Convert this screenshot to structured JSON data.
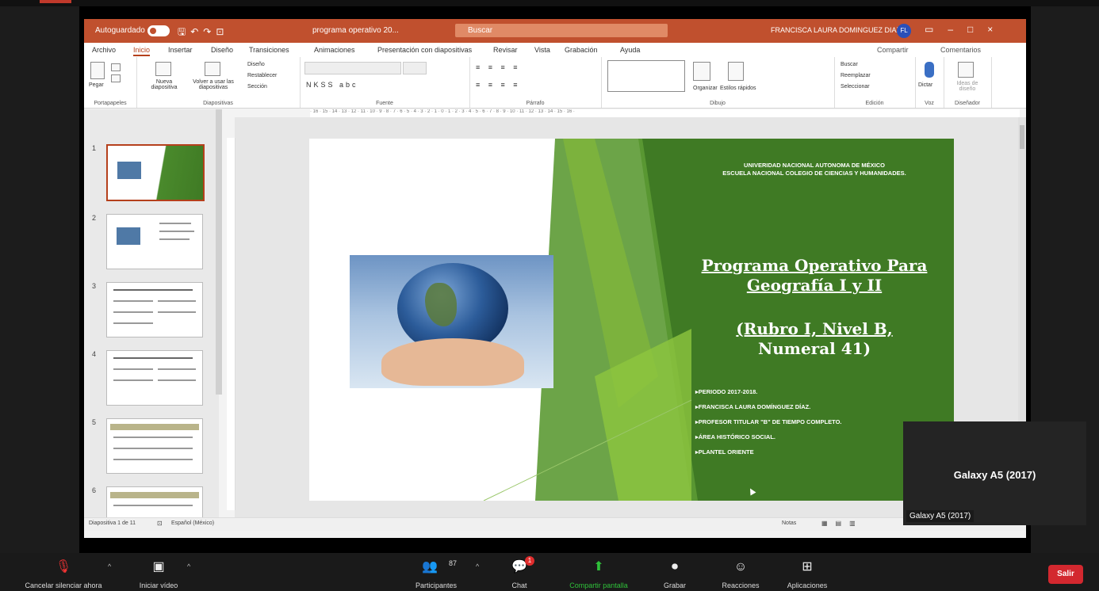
{
  "powerpoint": {
    "autosave_label": "Autoguardado",
    "filename": "programa operativo 20...",
    "search_placeholder": "Buscar",
    "user_name": "FRANCISCA LAURA DOMINGUEZ DIAZ",
    "user_initials": "FL",
    "tabs": [
      "Archivo",
      "Inicio",
      "Insertar",
      "Diseño",
      "Transiciones",
      "Animaciones",
      "Presentación con diapositivas",
      "Revisar",
      "Vista",
      "Grabación",
      "Ayuda"
    ],
    "active_tab": "Inicio",
    "share_label": "Compartir",
    "comments_label": "Comentarios",
    "ribbon_groups": [
      "Portapapeles",
      "Diapositivas",
      "Fuente",
      "Párrafo",
      "Dibujo",
      "Edición",
      "Voz",
      "Diseñador"
    ],
    "ribbon_buttons": {
      "paste": "Pegar",
      "new_slide": "Nueva diapositiva",
      "reuse": "Volver a usar las diapositivas",
      "layout": "Diseño",
      "reset": "Restablecer",
      "section": "Sección",
      "arrange": "Organizar",
      "quick_styles": "Estilos rápidos",
      "find": "Buscar",
      "replace": "Reemplazar",
      "select": "Seleccionar",
      "dictate": "Dictar",
      "designer": "Ideas de diseño"
    },
    "thumbnail_numbers": [
      "1",
      "2",
      "3",
      "4",
      "5",
      "6"
    ],
    "selected_thumbnail": 1,
    "status": {
      "slide_info": "Diapositiva 1 de 11",
      "language": "Español (México)",
      "notes": "Notas"
    }
  },
  "slide": {
    "university": "UNIVERIDAD NACIONAL AUTONOMA DE MÉXICO",
    "school": "ESCUELA NACIONAL COLEGIO DE CIENCIAS Y HUMANIDADES.",
    "title_line1": "Programa Operativo Para",
    "title_line2": "Geografía I y II",
    "subtitle_line1": "(Rubro I, Nivel B,",
    "subtitle_line2": "Numeral 41)",
    "bullets": [
      "PERIODO 2017-2018.",
      "FRANCISCA LAURA DOMÍNGUEZ DÍAZ.",
      "PROFESOR TITULAR \"B\" DE TIEMPO COMPLETO.",
      "ÁREA HISTÓRICO SOCIAL.",
      "PLANTEL ORIENTE"
    ],
    "green_color": "#3f7a24"
  },
  "participant_tile": {
    "name": "Galaxy A5 (2017)",
    "label": "Galaxy A5 (2017)"
  },
  "zoom_toolbar": {
    "unmute": "Cancelar silenciar ahora",
    "start_video": "Iniciar vídeo",
    "participants": "Participantes",
    "participants_count": "87",
    "chat": "Chat",
    "chat_badge": "1",
    "share_screen": "Compartir pantalla",
    "record": "Grabar",
    "reactions": "Reacciones",
    "apps": "Aplicaciones",
    "leave": "Salir"
  }
}
